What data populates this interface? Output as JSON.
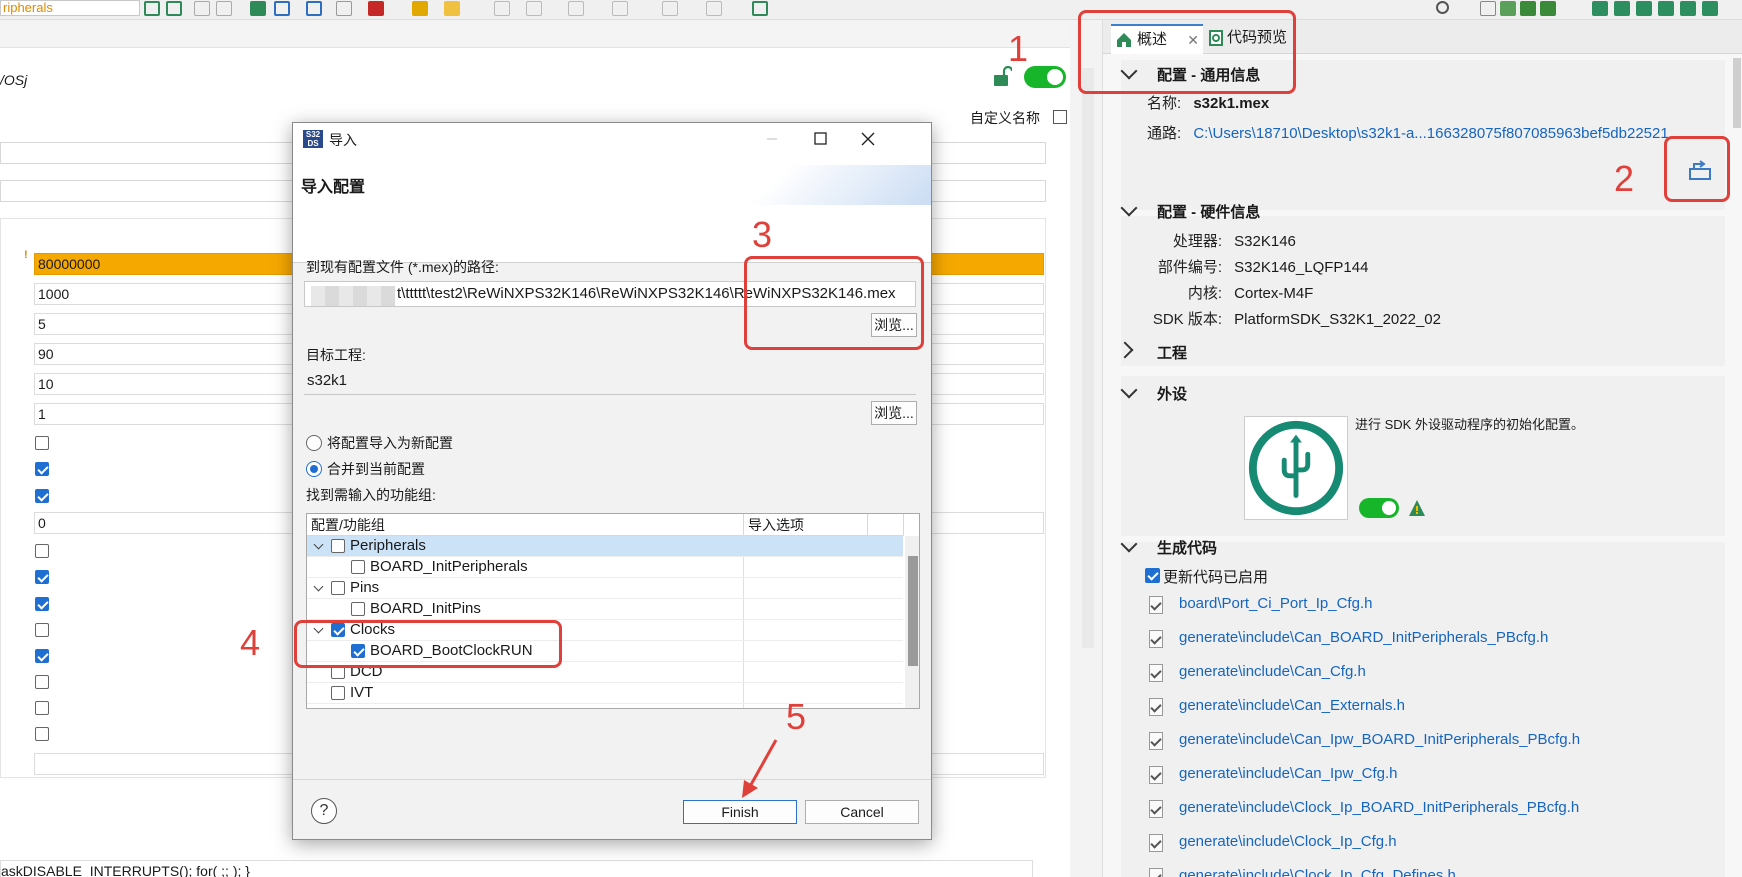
{
  "toolbar": {
    "combo_text": "ripherals"
  },
  "left": {
    "title": "/OSj",
    "custom_name_label": "自定义名称",
    "fields": [
      {
        "value": "80000000",
        "warning": true
      },
      {
        "value": "1000"
      },
      {
        "value": "5"
      },
      {
        "value": "90"
      },
      {
        "value": "10"
      },
      {
        "value": "1"
      }
    ],
    "single_field": "0",
    "checkboxes_a": [
      false,
      true,
      true
    ],
    "checkboxes_b": [
      false,
      true,
      true,
      false,
      true,
      false,
      false,
      false
    ],
    "task_line": "askDISABLE_INTERRUPTS(); for( ;; ); }",
    "accent_colors": {
      "warning_field": "#f5a800",
      "toggle_on": "#17b52a",
      "checkbox_on": "#1e6fd1"
    }
  },
  "right": {
    "tabs": [
      {
        "label": "概述",
        "icon": "home-icon",
        "closable": true
      },
      {
        "label": "代码预览",
        "icon": "code-preview-icon"
      }
    ],
    "general": {
      "header": "配置 - 通用信息",
      "name_label": "名称:",
      "name_value": "s32k1.mex",
      "path_label": "通路:",
      "path_value": "C:\\Users\\18710\\Desktop\\s32k1-a...166328075f807085963bef5db22521"
    },
    "hardware": {
      "header": "配置 - 硬件信息",
      "rows": [
        {
          "label": "处理器:",
          "value": "S32K146"
        },
        {
          "label": "部件编号:",
          "value": "S32K146_LQFP144"
        },
        {
          "label": "内核:",
          "value": "Cortex-M4F"
        },
        {
          "label": "SDK 版本:",
          "value": "PlatformSDK_S32K1_2022_02"
        }
      ]
    },
    "project": {
      "header": "工程"
    },
    "peripherals": {
      "header": "外设",
      "description": "进行 SDK 外设驱动程序的初始化配置。"
    },
    "generate": {
      "header": "生成代码",
      "update_label": "更新代码已启用",
      "files": [
        "board\\Port_Ci_Port_Ip_Cfg.h",
        "generate\\include\\Can_BOARD_InitPeripherals_PBcfg.h",
        "generate\\include\\Can_Cfg.h",
        "generate\\include\\Can_Externals.h",
        "generate\\include\\Can_Ipw_BOARD_InitPeripherals_PBcfg.h",
        "generate\\include\\Can_Ipw_Cfg.h",
        "generate\\include\\Clock_Ip_BOARD_InitPeripherals_PBcfg.h",
        "generate\\include\\Clock_Ip_Cfg.h",
        "generate\\include\\Clock_Ip_Cfg_Defines.h"
      ]
    }
  },
  "dialog": {
    "window_title": "导入",
    "app_icon_text": "S32 DS",
    "header_title": "导入配置",
    "path_label": "到现有配置文件 (*.mex)的路径:",
    "path_value": "t\\ttttt\\test2\\ReWiNXPS32K146\\ReWiNXPS32K146\\ReWiNXPS32K146.mex",
    "browse_label": "浏览...",
    "target_label": "目标工程:",
    "target_value": "s32k1",
    "radio_new": "将配置导入为新配置",
    "radio_merge": "合并到当前配置",
    "radio_selected": "merge",
    "groups_label": "找到需输入的功能组:",
    "tree": {
      "col_name": "配置/功能组",
      "col_option": "导入选项",
      "rows": [
        {
          "label": "Peripherals",
          "level": 0,
          "expanded": true,
          "checked": false,
          "selected": true
        },
        {
          "label": "BOARD_InitPeripherals",
          "level": 1,
          "checked": false
        },
        {
          "label": "Pins",
          "level": 0,
          "expanded": true,
          "checked": false
        },
        {
          "label": "BOARD_InitPins",
          "level": 1,
          "checked": false
        },
        {
          "label": "Clocks",
          "level": 0,
          "expanded": true,
          "checked": true
        },
        {
          "label": "BOARD_BootClockRUN",
          "level": 1,
          "checked": true
        },
        {
          "label": "DCD",
          "level": 0,
          "checked": false
        },
        {
          "label": "IVT",
          "level": 0,
          "checked": false
        }
      ]
    },
    "help_label": "?",
    "finish_label": "Finish",
    "cancel_label": "Cancel"
  },
  "annotations": {
    "numbers": [
      "1",
      "2",
      "3",
      "4",
      "5"
    ],
    "color": "#e0403a"
  }
}
